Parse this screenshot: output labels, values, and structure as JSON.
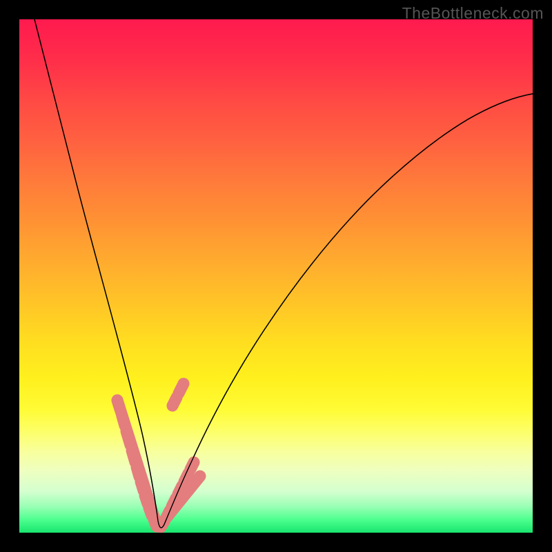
{
  "watermark": "TheBottleneck.com",
  "chart_data": {
    "type": "line",
    "title": "",
    "xlabel": "",
    "ylabel": "",
    "xlim": [
      0,
      100
    ],
    "ylim": [
      0,
      100
    ],
    "grid": false,
    "legend": false,
    "description": "Bottleneck curve: V-shape with minimum near x≈27 (0% mismatch). Rises sharply below and gradually above. Axes unlabeled. Background gradient green(bottom=good)→yellow→orange→red(top=bad).",
    "series": [
      {
        "name": "bottleneck_curve",
        "x": [
          3,
          5,
          8,
          11,
          14,
          17,
          20,
          22,
          24,
          26,
          27,
          28,
          30,
          33,
          37,
          42,
          48,
          55,
          62,
          70,
          78,
          86,
          94,
          100
        ],
        "y": [
          100,
          86,
          68,
          52,
          38,
          27,
          18,
          10,
          5,
          1.5,
          0.8,
          1.2,
          3.5,
          8,
          15,
          24,
          34,
          44,
          53,
          62,
          69,
          75,
          80,
          83
        ]
      }
    ],
    "highlight_band": {
      "name": "acceptable_zone_markers",
      "left_segment_x": [
        19,
        26
      ],
      "left_segment_y": [
        20,
        2
      ],
      "right_segment_x": [
        28,
        35
      ],
      "right_segment_y": [
        1.5,
        11
      ],
      "note": "Salmon pink markers on both flanks of the V indicating a low-bottleneck zone"
    }
  }
}
